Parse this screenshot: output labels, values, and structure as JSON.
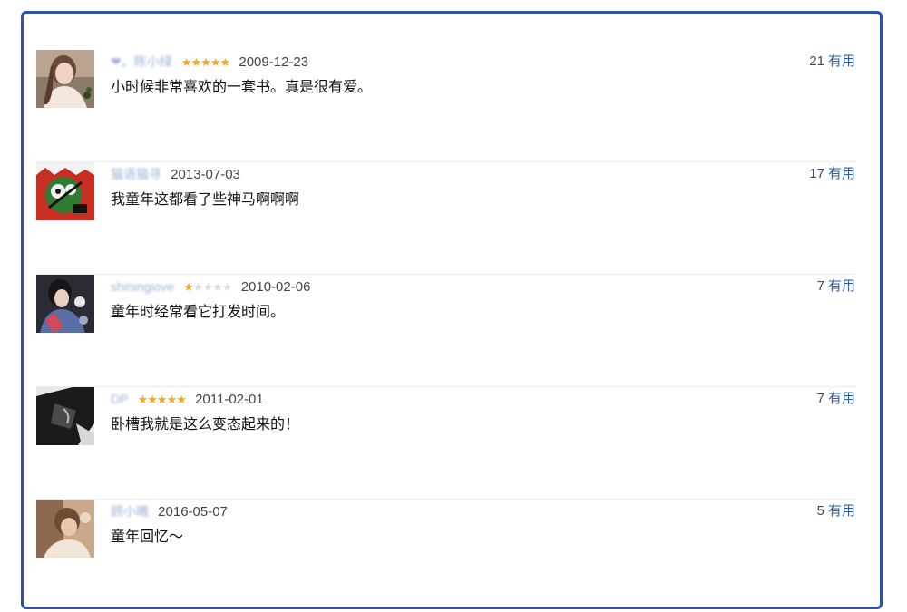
{
  "comments": [
    {
      "user": "❤。陈小绿",
      "rating": 5,
      "date": "2009-12-23",
      "text": "小时候非常喜欢的一套书。真是很有爱。",
      "votes": "21",
      "votes_label": "有用",
      "avatar_icon": "girl-portrait-avatar"
    },
    {
      "user": "猫语猫寻",
      "rating": 0,
      "date": "2013-07-03",
      "text": "我童年这都看了些神马啊啊啊",
      "votes": "17",
      "votes_label": "有用",
      "avatar_icon": "cartoon-red-avatar"
    },
    {
      "user": "shiningiove",
      "rating": 1,
      "date": "2010-02-06",
      "text": "童年时经常看它打发时间。",
      "votes": "7",
      "votes_label": "有用",
      "avatar_icon": "dark-portrait-avatar"
    },
    {
      "user": "DP",
      "rating": 5,
      "date": "2011-02-01",
      "text": "卧槽我就是这么变态起来的！",
      "votes": "7",
      "votes_label": "有用",
      "avatar_icon": "black-white-avatar"
    },
    {
      "user": "顾小曦",
      "rating": 0,
      "date": "2016-05-07",
      "text": "童年回忆～",
      "votes": "5",
      "votes_label": "有用",
      "avatar_icon": "photo-portrait-avatar"
    }
  ],
  "colors": {
    "frame": "#2f4fb5",
    "link": "#2f5ea8",
    "star": "#f5a623"
  }
}
